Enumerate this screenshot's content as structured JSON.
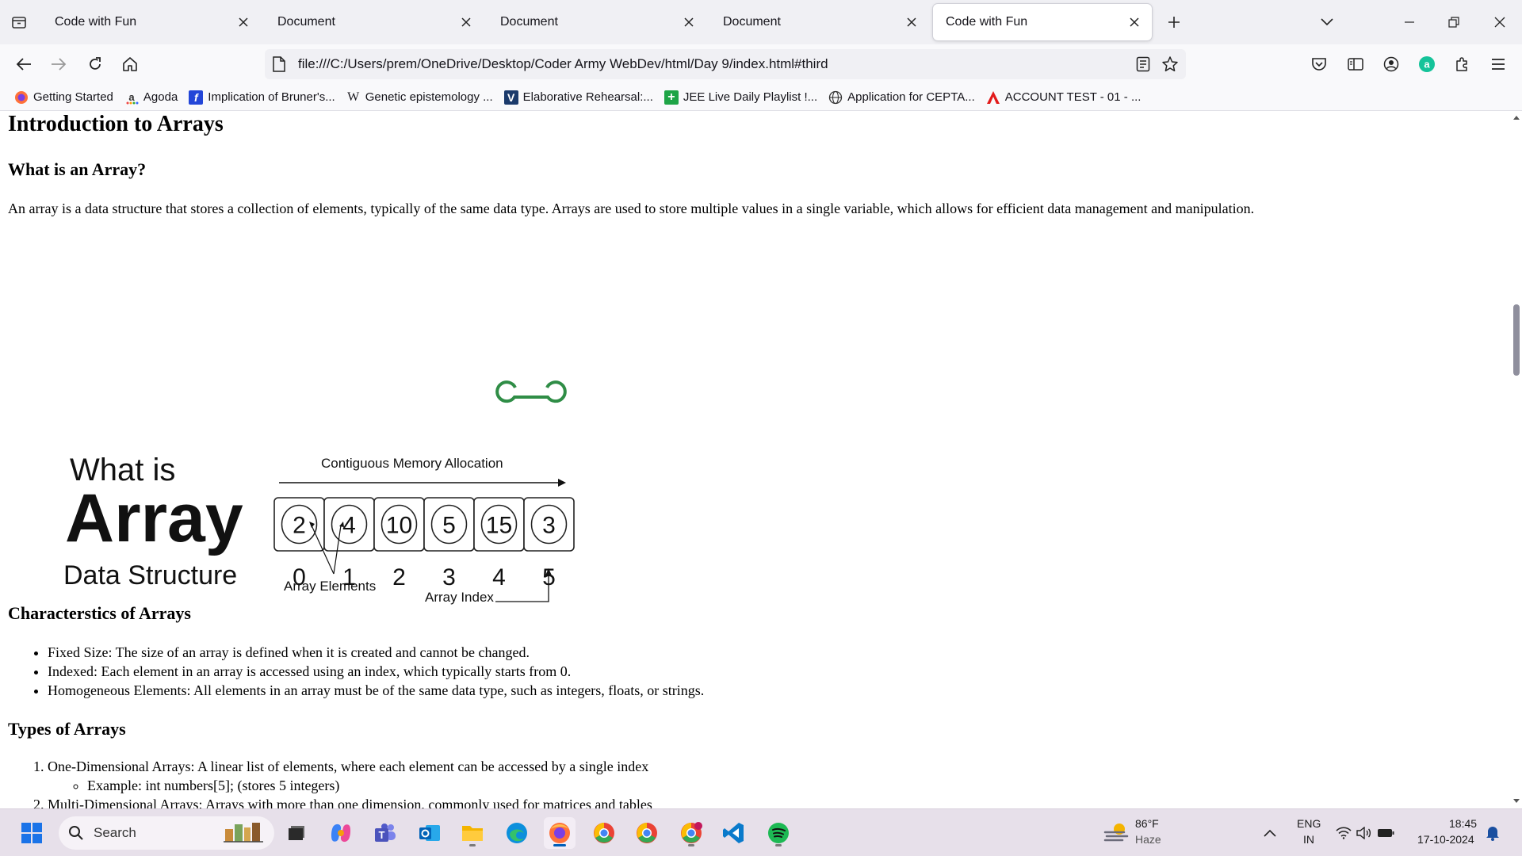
{
  "tabs": [
    {
      "label": "Code with Fun",
      "active": false
    },
    {
      "label": "Document",
      "active": false
    },
    {
      "label": "Document",
      "active": false
    },
    {
      "label": "Document",
      "active": false
    },
    {
      "label": "Code with Fun",
      "active": true
    }
  ],
  "address_bar": {
    "url": "file:///C:/Users/prem/OneDrive/Desktop/Coder Army WebDev/html/Day 9/index.html#third"
  },
  "bookmarks": [
    {
      "label": "Getting Started",
      "icon": "firefox-icon"
    },
    {
      "label": "Agoda",
      "icon": "agoda-icon"
    },
    {
      "label": "Implication of Bruner's...",
      "icon": "bruner-icon"
    },
    {
      "label": "Genetic epistemology ...",
      "icon": "wikipedia-icon"
    },
    {
      "label": "Elaborative Rehearsal:...",
      "icon": "verywell-icon"
    },
    {
      "label": "JEE Live Daily Playlist !...",
      "icon": "plus-icon"
    },
    {
      "label": "Application for CEPTA...",
      "icon": "globe-icon"
    },
    {
      "label": "ACCOUNT TEST - 01 - ...",
      "icon": "a-icon"
    }
  ],
  "page": {
    "title": "Introduction to Arrays",
    "what_heading": "What is an Array?",
    "what_text": "An array is a data structure that stores a collection of elements, typically of the same data type. Arrays are used to store multiple values in a single variable, which allows for efficient data management and manipulation.",
    "char_heading": "Characterstics of Arrays",
    "characteristics": [
      "Fixed Size: The size of an array is defined when it is created and cannot be changed.",
      "Indexed: Each element in an array is accessed using an index, which typically starts from 0.",
      "Homogeneous Elements: All elements in an array must be of the same data type, such as integers, floats, or strings."
    ],
    "types_heading": "Types of Arrays",
    "types": [
      {
        "text": "One-Dimensional Arrays: A linear list of elements, where each element can be accessed by a single index",
        "sub": "Example: int numbers[5]; (stores 5 integers)"
      },
      {
        "text": "Multi-Dimensional Arrays: Arrays with more than one dimension, commonly used for matrices and tables"
      }
    ]
  },
  "diagram": {
    "logo": "GG",
    "what_is": "What is",
    "array": "Array",
    "data_structure": "Data Structure",
    "contiguous": "Contiguous Memory Allocation",
    "values": [
      "2",
      "4",
      "10",
      "5",
      "15",
      "3"
    ],
    "indices": [
      "0",
      "1",
      "2",
      "3",
      "4",
      "5"
    ],
    "elements_label": "Array Elements",
    "index_label": "Array Index",
    "logo_color": "#2f8d46"
  },
  "taskbar": {
    "search_placeholder": "Search",
    "weather_temp": "86°F",
    "weather_desc": "Haze",
    "lang_1": "ENG",
    "lang_2": "IN",
    "time": "18:45",
    "date": "17-10-2024"
  }
}
